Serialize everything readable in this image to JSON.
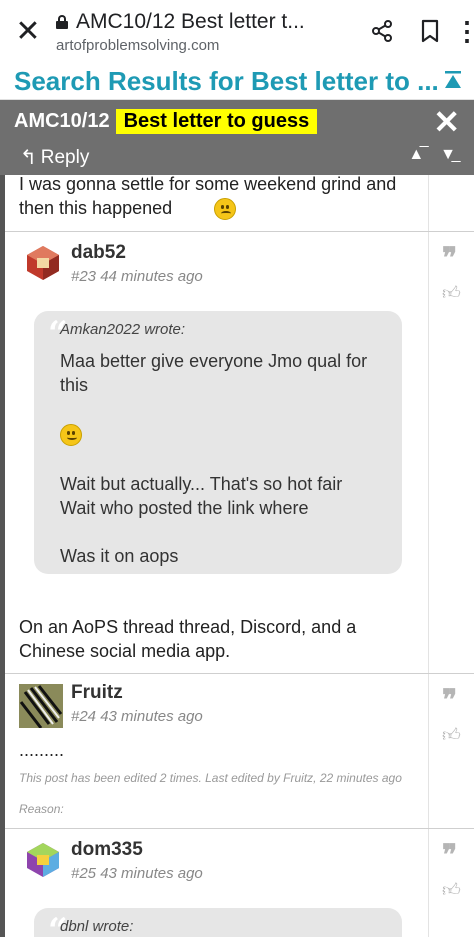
{
  "browser": {
    "page_title": "AMC10/12 Best letter t...",
    "url": "artofproblemsolving.com"
  },
  "search": {
    "title": "Search Results for Best letter to ..."
  },
  "topic": {
    "forum": "AMC10/12",
    "subject": "Best letter to guess",
    "reply_label": "Reply"
  },
  "posts": [
    {
      "text": "I was gonna settle for some weekend grind and then this happened"
    },
    {
      "user": "dab52",
      "num": "#23",
      "time": "44 minutes ago",
      "quote_author": "Amkan2022 wrote:",
      "quote_lines": [
        "Maa better give everyone Jmo qual for",
        "this",
        "Wait but actually... That's so hot fair",
        "Wait who posted the link where",
        "Was it on aops"
      ],
      "text_lines": [
        "On an AoPS thread thread, Discord, and a",
        "Chinese social media app."
      ]
    },
    {
      "user": "Fruitz",
      "num": "#24",
      "time": "43 minutes ago",
      "text": ".........",
      "edited": "This post has been edited 2 times. Last edited by Fruitz, 22 minutes ago",
      "reason": "Reason:"
    },
    {
      "user": "dom335",
      "num": "#25",
      "time": "43 minutes ago",
      "quote_author": "dbnl wrote:"
    }
  ]
}
